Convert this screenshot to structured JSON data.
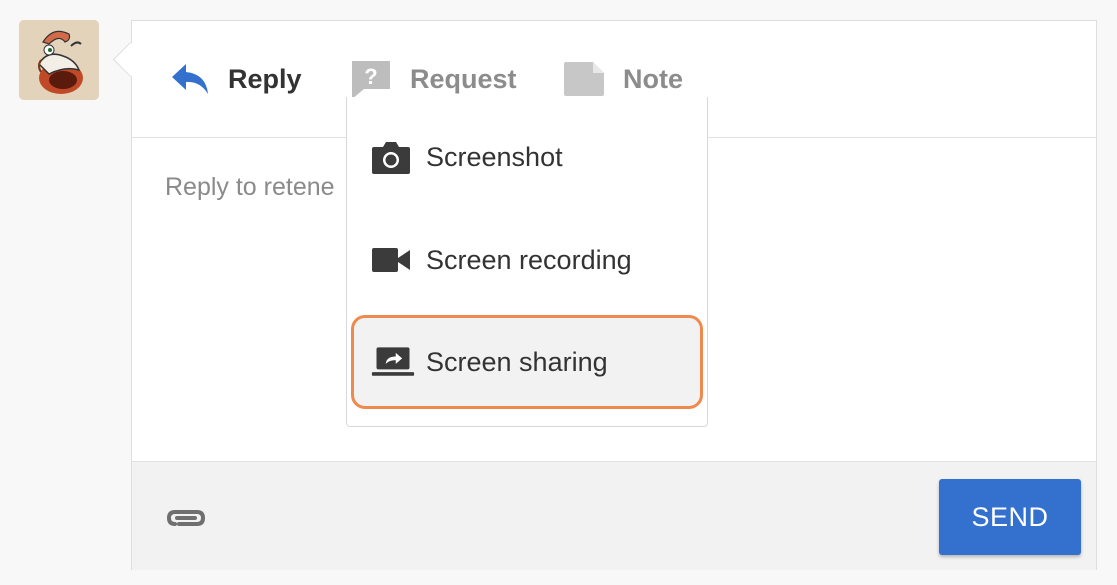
{
  "avatar": {
    "icon": "earthworm-jim-avatar"
  },
  "tabs": [
    {
      "label": "Reply",
      "icon": "reply-arrow-icon",
      "active": true
    },
    {
      "label": "Request",
      "icon": "question-bubble-icon",
      "active": false
    },
    {
      "label": "Note",
      "icon": "note-icon",
      "active": false
    }
  ],
  "composer": {
    "placeholder": "Reply to retene"
  },
  "dropdown": {
    "items": [
      {
        "label": "Screenshot",
        "icon": "camera-icon"
      },
      {
        "label": "Screen recording",
        "icon": "video-camera-icon"
      },
      {
        "label": "Screen sharing",
        "icon": "screen-share-icon",
        "highlighted": true
      }
    ]
  },
  "footer": {
    "attach_icon": "paperclip-icon",
    "send_label": "SEND"
  },
  "colors": {
    "accent": "#3471cf",
    "highlight": "#ef8a4f",
    "muted": "#8c8c8c"
  }
}
